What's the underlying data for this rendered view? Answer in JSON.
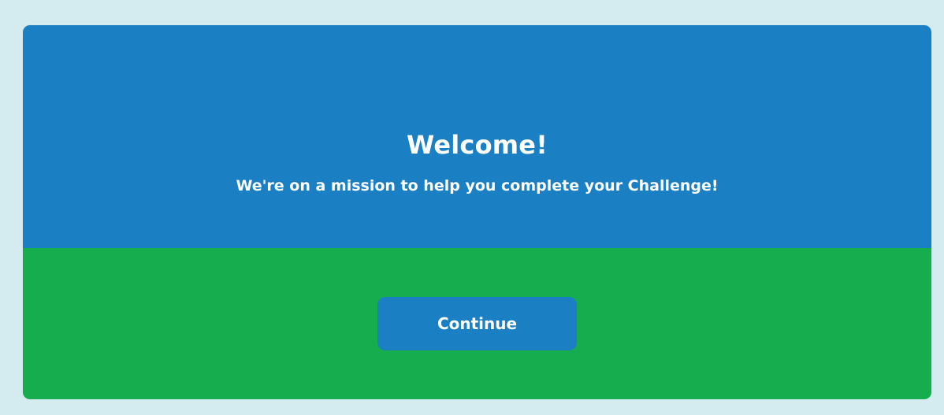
{
  "welcome": {
    "title": "Welcome!",
    "subtitle": "We're on a mission to help you complete your Challenge!"
  },
  "actions": {
    "continue_label": "Continue"
  },
  "colors": {
    "page_background": "#d4ebf0",
    "header_background": "#1b7fc4",
    "footer_background": "#16ad4e",
    "button_background": "#1b7fc4",
    "text": "#ffffff"
  }
}
